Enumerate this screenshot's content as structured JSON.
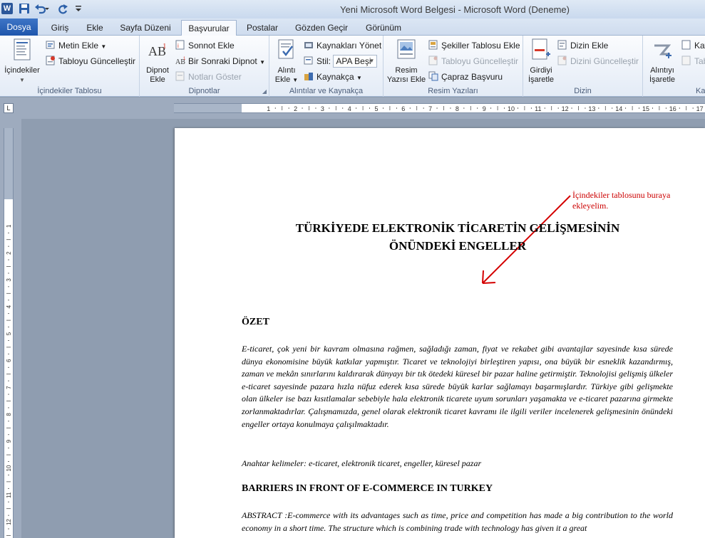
{
  "window": {
    "title": "Yeni Microsoft Word Belgesi  -  Microsoft Word (Deneme)",
    "app_icon_letter": "W"
  },
  "quick_access": {
    "save_icon": "save-icon",
    "undo_icon": "undo-icon",
    "redo_icon": "redo-icon",
    "customize_icon": "customize-qat-icon"
  },
  "tabs": [
    {
      "label": "Dosya"
    },
    {
      "label": "Giriş"
    },
    {
      "label": "Ekle"
    },
    {
      "label": "Sayfa Düzeni"
    },
    {
      "label": "Başvurular"
    },
    {
      "label": "Postalar"
    },
    {
      "label": "Gözden Geçir"
    },
    {
      "label": "Görünüm"
    }
  ],
  "ribbon": {
    "toc": {
      "group_label": "İçindekiler Tablosu",
      "big_label": "İçindekiler",
      "add_text": "Metin Ekle",
      "update_table": "Tabloyu Güncelleştir"
    },
    "footnotes": {
      "group_label": "Dipnotlar",
      "big_label_1": "Dipnot",
      "big_label_2": "Ekle",
      "endnote": "Sonnot Ekle",
      "next_footnote": "Bir Sonraki Dipnot",
      "show_notes": "Notları Göster"
    },
    "citations": {
      "group_label": "Alıntılar ve Kaynakça",
      "big_label_1": "Alıntı",
      "big_label_2": "Ekle",
      "manage_sources": "Kaynakları Yönet",
      "style_label": "Stil:",
      "style_value": "APA Beşi",
      "bibliography": "Kaynakça"
    },
    "captions": {
      "group_label": "Resim Yazıları",
      "big_label_1": "Resim",
      "big_label_2": "Yazısı Ekle",
      "table_of_figures": "Şekiller Tablosu Ekle",
      "update_table": "Tabloyu Güncelleştir",
      "cross_reference": "Çapraz Başvuru"
    },
    "index": {
      "group_label": "Dizin",
      "big_label_1": "Girdiyi",
      "big_label_2": "İşaretle",
      "insert_index": "Dizin Ekle",
      "update_index": "Dizini Güncelleştir"
    },
    "authorities": {
      "group_label": "Ka",
      "big_label_1": "Alıntıyı",
      "big_label_2": "İşaretle",
      "item_1": "Kay",
      "item_2": "Tab"
    }
  },
  "document": {
    "annotation": "İçindekiler tablosunu buraya ekleyelim.",
    "title_line1": "TÜRKİYEDE ELEKTRONİK TİCARETİN GELİŞMESİNİN",
    "title_line2": "ÖNÜNDEKİ ENGELLER",
    "summary_heading": "ÖZET",
    "summary_text": "E-ticaret, çok yeni bir kavram olmasına rağmen, sağladığı zaman, fiyat ve rekabet gibi avantajlar sayesinde kısa sürede dünya ekonomisine büyük katkılar yapmıştır. Ticaret ve teknolojiyi birleştiren yapısı, ona büyük bir esneklik kazandırmış, zaman ve mekân sınırlarını kaldırarak dünyayı bir tık ötedeki küresel bir pazar haline getirmiştir. Teknolojisi gelişmiş ülkeler e-ticaret sayesinde pazara hızla nüfuz ederek kısa sürede büyük karlar sağlamayı başarmışlardır. Türkiye gibi gelişmekte olan ülkeler ise bazı kısıtlamalar sebebiyle hala elektronik ticarete uyum sorunları yaşamakta ve e-ticaret pazarına girmekte zorlanmaktadırlar. Çalışmamızda, genel olarak elektronik ticaret kavramı ile ilgili veriler incelenerek gelişmesinin önündeki engeller ortaya konulmaya çalışılmaktadır.",
    "keywords": "Anahtar kelimeler: e-ticaret, elektronik ticaret, engeller, küresel pazar",
    "english_heading": "BARRIERS IN FRONT OF E-COMMERCE IN TURKEY",
    "abstract_text": "ABSTRACT :E-commerce  with its advantages such as time, price and competition has made a big contribution to the world economy in a short time. The structure which is combining trade with technology has given it a great"
  },
  "ruler": {
    "h_numbers": [
      "2",
      "1",
      "1",
      "2",
      "3",
      "4",
      "5",
      "6",
      "7",
      "8",
      "9",
      "10",
      "11",
      "12",
      "13",
      "14",
      "15",
      "16",
      "17"
    ],
    "v_numbers": [
      "2",
      "1",
      "1",
      "2",
      "3",
      "4",
      "5",
      "6",
      "7",
      "8",
      "9",
      "10",
      "11",
      "12"
    ]
  }
}
